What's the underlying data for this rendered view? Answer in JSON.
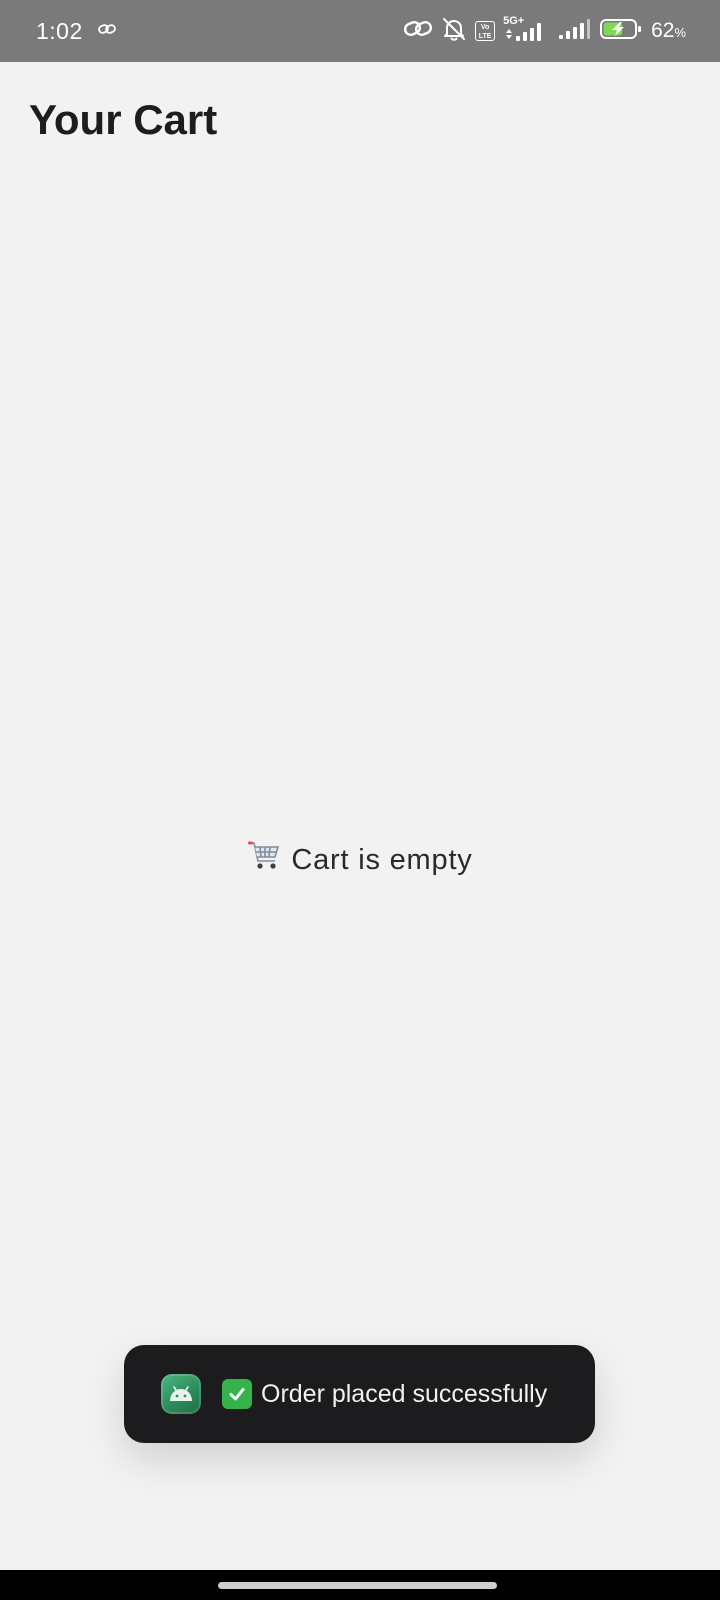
{
  "status_bar": {
    "time": "1:02",
    "network_5g": "5G+",
    "volte_line1": "Vo",
    "volte_line2": "LTE",
    "battery_value": "62",
    "battery_unit": "%",
    "battery_level": 0.62,
    "icons": [
      "link-icon",
      "link-icon",
      "bell-off-icon",
      "volte-icon",
      "signal-5g-icon",
      "signal-icon",
      "battery-charging-icon"
    ]
  },
  "header": {
    "title": "Your Cart"
  },
  "cart": {
    "empty_icon": "shopping-cart-icon",
    "empty_message": "Cart is empty"
  },
  "toast": {
    "app_icon": "android-app-icon",
    "check_icon": "check-mark-icon",
    "message": "Order placed successfully"
  },
  "colors": {
    "status_bar_bg": "#7a7a7a",
    "page_bg": "#f2f2f2",
    "toast_bg": "#1c1b1d",
    "check_green": "#35b24a",
    "battery_green": "#7ed957"
  }
}
